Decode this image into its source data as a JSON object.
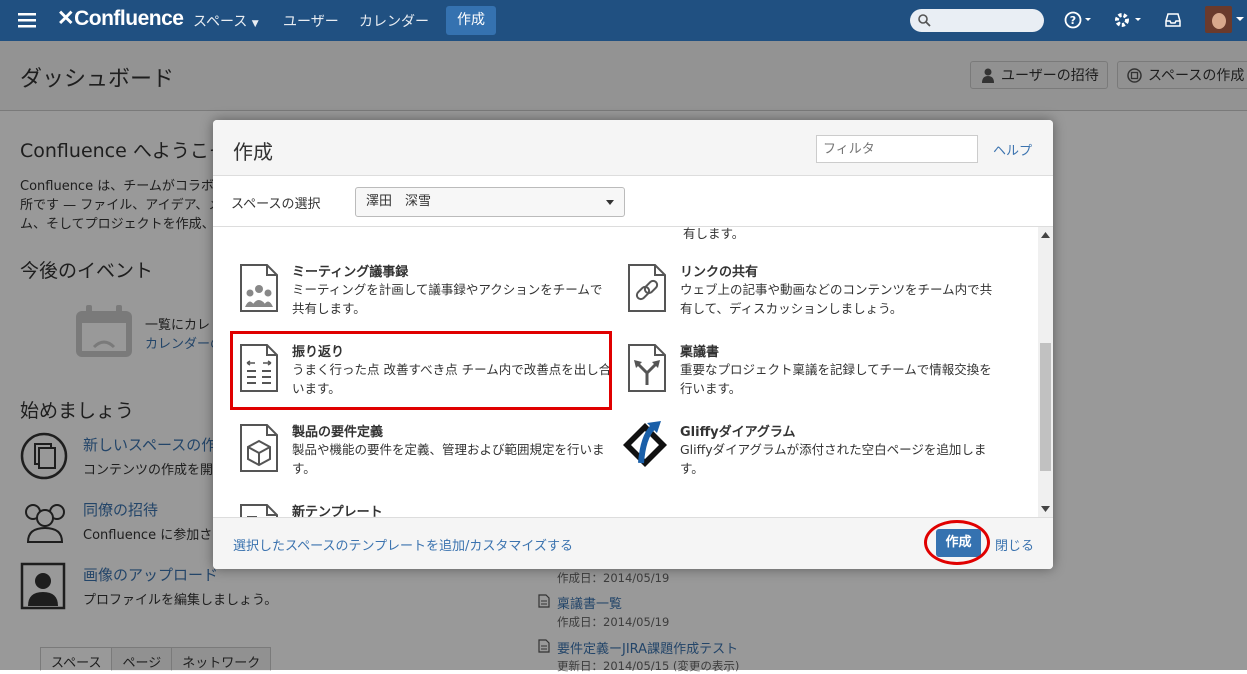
{
  "nav": {
    "logo": "Confluence",
    "spaces": "スペース",
    "users": "ユーザー",
    "calendar": "カレンダー",
    "create": "作成"
  },
  "page": {
    "title": "ダッシュボード",
    "invite_button": "ユーザーの招待",
    "space_dir_button": "スペースの作成",
    "welcome_title": "Confluence へようこそ",
    "welcome_line1": "Confluence は、チームがコラボレ",
    "welcome_line2": "所です — ファイル、アイデア、メ",
    "welcome_line3": "ム、そしてプロジェクトを作成、共有",
    "events_title": "今後のイベント",
    "events_text": "一覧にカレ",
    "events_link": "カレンダーの",
    "start_title": "始めましょう",
    "start_items": [
      {
        "title": "新しいスペースの作",
        "desc": "コンテンツの作成を開"
      },
      {
        "title": "同僚の招待",
        "desc": "Confluence に参加さ"
      },
      {
        "title": "画像のアップロード",
        "desc": "プロファイルを編集しましょう。"
      }
    ],
    "tabs": [
      "スペース",
      "ページ",
      "ネットワーク"
    ],
    "recent": [
      {
        "meta": "作成日：2014/05/19"
      },
      {
        "title": "稟議書一覧",
        "meta": "作成日：2014/05/19"
      },
      {
        "title": "要件定義ーJIRA課題作成テスト",
        "meta": "更新日：2014/05/15 (変更の表示)"
      }
    ]
  },
  "dialog": {
    "title": "作成",
    "filter_placeholder": "フィルタ",
    "help": "ヘルプ",
    "space_label": "スペースの選択",
    "space_value": "澤田　深雪",
    "truncated_top_text": "有します。",
    "templates": [
      {
        "name": "ミーティング議事録",
        "desc": "ミーティングを計画して議事録やアクションをチームで共有します。",
        "icon": "meeting-notes-icon"
      },
      {
        "name": "リンクの共有",
        "desc": "ウェブ上の記事や動画などのコンテンツをチーム内で共有して、ディスカッションしましょう。",
        "icon": "link-share-icon"
      },
      {
        "name": "振り返り",
        "desc": "うまく行った点 改善すべき点 チーム内で改善点を出し合います。",
        "icon": "retrospective-icon"
      },
      {
        "name": "稟議書",
        "desc": "重要なプロジェクト稟議を記録してチームで情報交換を行います。",
        "icon": "decision-icon"
      },
      {
        "name": "製品の要件定義",
        "desc": "製品や機能の要件を定義、管理および範囲規定を行います。",
        "icon": "requirements-icon"
      },
      {
        "name": "Gliffyダイアグラム",
        "desc": "Gliffyダイアグラムが添付された空白ページを追加します。",
        "icon": "gliffy-icon"
      },
      {
        "name": "新テンプレート",
        "desc": "",
        "icon": "blank-template-icon"
      }
    ],
    "customize_link": "選択したスペースのテンプレートを追加/カスタマイズする",
    "create_button": "作成",
    "close_link": "閉じる"
  },
  "colors": {
    "nav_bg": "#205081",
    "primary": "#3572b0",
    "link": "#3b73af",
    "highlight": "#e00000"
  }
}
